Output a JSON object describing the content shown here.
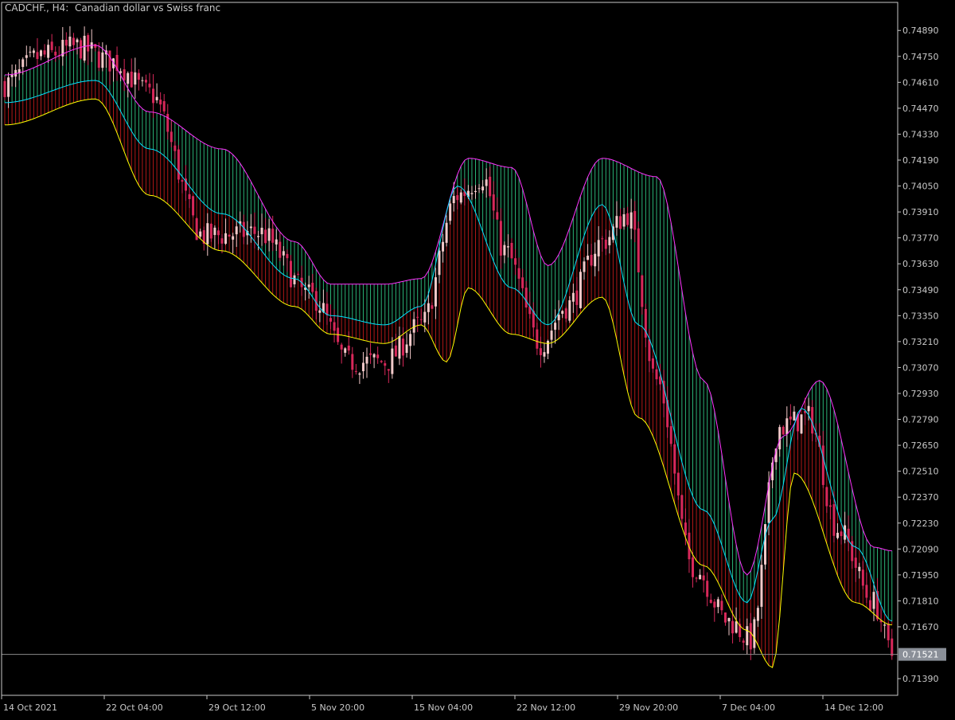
{
  "window": {
    "title": "CADCHF., H4:  Canadian dollar vs Swiss franc"
  },
  "colors": {
    "background": "#000000",
    "axis": "#c8c8c8",
    "text": "#c8c8c8",
    "bull_candle": "#f2c9c9",
    "bear_candle": "#d8285a",
    "upper_band": "#ff33ff",
    "middle_line": "#00e5ff",
    "lower_band": "#ffff00",
    "fill_upper": "#2bb377",
    "fill_lower": "#b01818",
    "price_line": "#8a8a8a",
    "price_label_bg": "#8a8f98"
  },
  "price_axis": {
    "labels": [
      "0.74890",
      "0.74750",
      "0.74610",
      "0.74470",
      "0.74330",
      "0.74190",
      "0.74050",
      "0.73910",
      "0.73770",
      "0.73630",
      "0.73490",
      "0.73350",
      "0.73210",
      "0.73070",
      "0.72930",
      "0.72790",
      "0.72650",
      "0.72510",
      "0.72370",
      "0.72230",
      "0.72090",
      "0.71950",
      "0.71810",
      "0.71670",
      "0.71390"
    ],
    "current_price": "0.71521"
  },
  "time_axis": {
    "labels": [
      "14 Oct 2021",
      "22 Oct 04:00",
      "29 Oct 12:00",
      "5 Nov 20:00",
      "15 Nov 04:00",
      "22 Nov 12:00",
      "29 Nov 20:00",
      "7 Dec 04:00",
      "14 Dec 12:00"
    ]
  },
  "chart_data": {
    "type": "candlestick",
    "symbol": "CADCHF.",
    "timeframe": "H4",
    "ylim": [
      0.713,
      0.7502
    ],
    "current_price": 0.71521,
    "candle_count": 246,
    "key_closes": [
      [
        0,
        0.746
      ],
      [
        10,
        0.7475
      ],
      [
        20,
        0.748
      ],
      [
        30,
        0.7472
      ],
      [
        40,
        0.7455
      ],
      [
        55,
        0.7378
      ],
      [
        70,
        0.738
      ],
      [
        85,
        0.7345
      ],
      [
        95,
        0.731
      ],
      [
        105,
        0.731
      ],
      [
        115,
        0.733
      ],
      [
        125,
        0.74
      ],
      [
        132,
        0.741
      ],
      [
        138,
        0.737
      ],
      [
        148,
        0.732
      ],
      [
        155,
        0.734
      ],
      [
        165,
        0.7375
      ],
      [
        172,
        0.739
      ],
      [
        180,
        0.73
      ],
      [
        190,
        0.72
      ],
      [
        200,
        0.717
      ],
      [
        206,
        0.716
      ],
      [
        214,
        0.7275
      ],
      [
        222,
        0.728
      ],
      [
        230,
        0.722
      ],
      [
        240,
        0.718
      ],
      [
        245,
        0.7152
      ]
    ],
    "indicators": [
      {
        "name": "upper band",
        "key_points": [
          [
            0,
            0.7465
          ],
          [
            25,
            0.7481
          ],
          [
            40,
            0.7445
          ],
          [
            60,
            0.7425
          ],
          [
            80,
            0.7375
          ],
          [
            90,
            0.7352
          ],
          [
            105,
            0.7352
          ],
          [
            115,
            0.7355
          ],
          [
            128,
            0.742
          ],
          [
            140,
            0.7415
          ],
          [
            150,
            0.7362
          ],
          [
            165,
            0.742
          ],
          [
            180,
            0.741
          ],
          [
            193,
            0.73
          ],
          [
            205,
            0.7195
          ],
          [
            215,
            0.727
          ],
          [
            225,
            0.73
          ],
          [
            240,
            0.721
          ],
          [
            245,
            0.7208
          ]
        ]
      },
      {
        "name": "middle line",
        "key_points": [
          [
            0,
            0.745
          ],
          [
            25,
            0.7462
          ],
          [
            40,
            0.7425
          ],
          [
            60,
            0.739
          ],
          [
            80,
            0.7355
          ],
          [
            90,
            0.7335
          ],
          [
            105,
            0.733
          ],
          [
            115,
            0.734
          ],
          [
            125,
            0.7405
          ],
          [
            140,
            0.735
          ],
          [
            150,
            0.733
          ],
          [
            165,
            0.7395
          ],
          [
            175,
            0.733
          ],
          [
            193,
            0.723
          ],
          [
            205,
            0.718
          ],
          [
            212,
            0.7225
          ],
          [
            220,
            0.7285
          ],
          [
            235,
            0.721
          ],
          [
            245,
            0.717
          ]
        ]
      },
      {
        "name": "lower band",
        "key_points": [
          [
            0,
            0.7438
          ],
          [
            25,
            0.7452
          ],
          [
            40,
            0.74
          ],
          [
            60,
            0.737
          ],
          [
            80,
            0.734
          ],
          [
            90,
            0.7325
          ],
          [
            105,
            0.732
          ],
          [
            115,
            0.733
          ],
          [
            122,
            0.731
          ],
          [
            128,
            0.735
          ],
          [
            140,
            0.7325
          ],
          [
            150,
            0.732
          ],
          [
            165,
            0.7345
          ],
          [
            175,
            0.728
          ],
          [
            193,
            0.72
          ],
          [
            205,
            0.7165
          ],
          [
            212,
            0.7145
          ],
          [
            218,
            0.725
          ],
          [
            235,
            0.718
          ],
          [
            245,
            0.7168
          ]
        ]
      }
    ]
  }
}
